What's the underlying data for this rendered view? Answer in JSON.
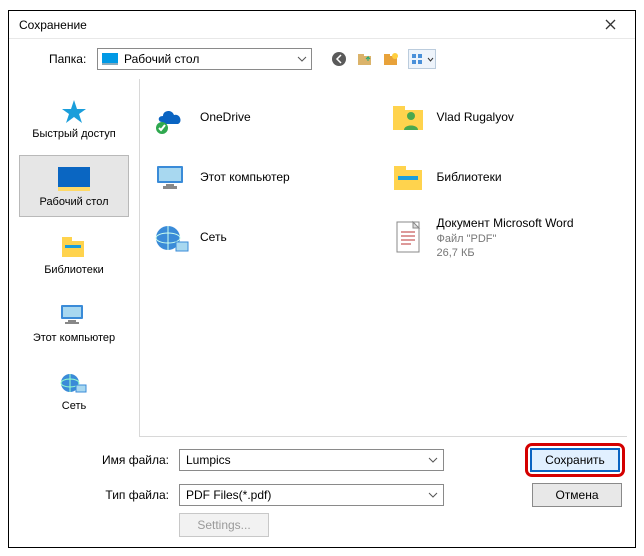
{
  "dialog": {
    "title": "Сохранение"
  },
  "toolbar": {
    "folder_label": "Папка:",
    "current_folder": "Рабочий стол"
  },
  "sidebar": {
    "items": [
      {
        "label": "Быстрый доступ"
      },
      {
        "label": "Рабочий стол"
      },
      {
        "label": "Библиотеки"
      },
      {
        "label": "Этот компьютер"
      },
      {
        "label": "Сеть"
      }
    ]
  },
  "content": {
    "items": [
      {
        "label": "OneDrive"
      },
      {
        "label": "Vlad Rugalyov"
      },
      {
        "label": "Этот компьютер"
      },
      {
        "label": "Библиотеки"
      },
      {
        "label": "Сеть"
      },
      {
        "label": "Документ Microsoft Word",
        "sub1": "Файл \"PDF\"",
        "sub2": "26,7 КБ"
      }
    ]
  },
  "bottom": {
    "filename_label": "Имя файла:",
    "filename_value": "Lumpics",
    "type_label": "Тип файла:",
    "type_value": "PDF Files(*.pdf)",
    "save_label": "Сохранить",
    "cancel_label": "Отмена",
    "settings_label": "Settings..."
  }
}
